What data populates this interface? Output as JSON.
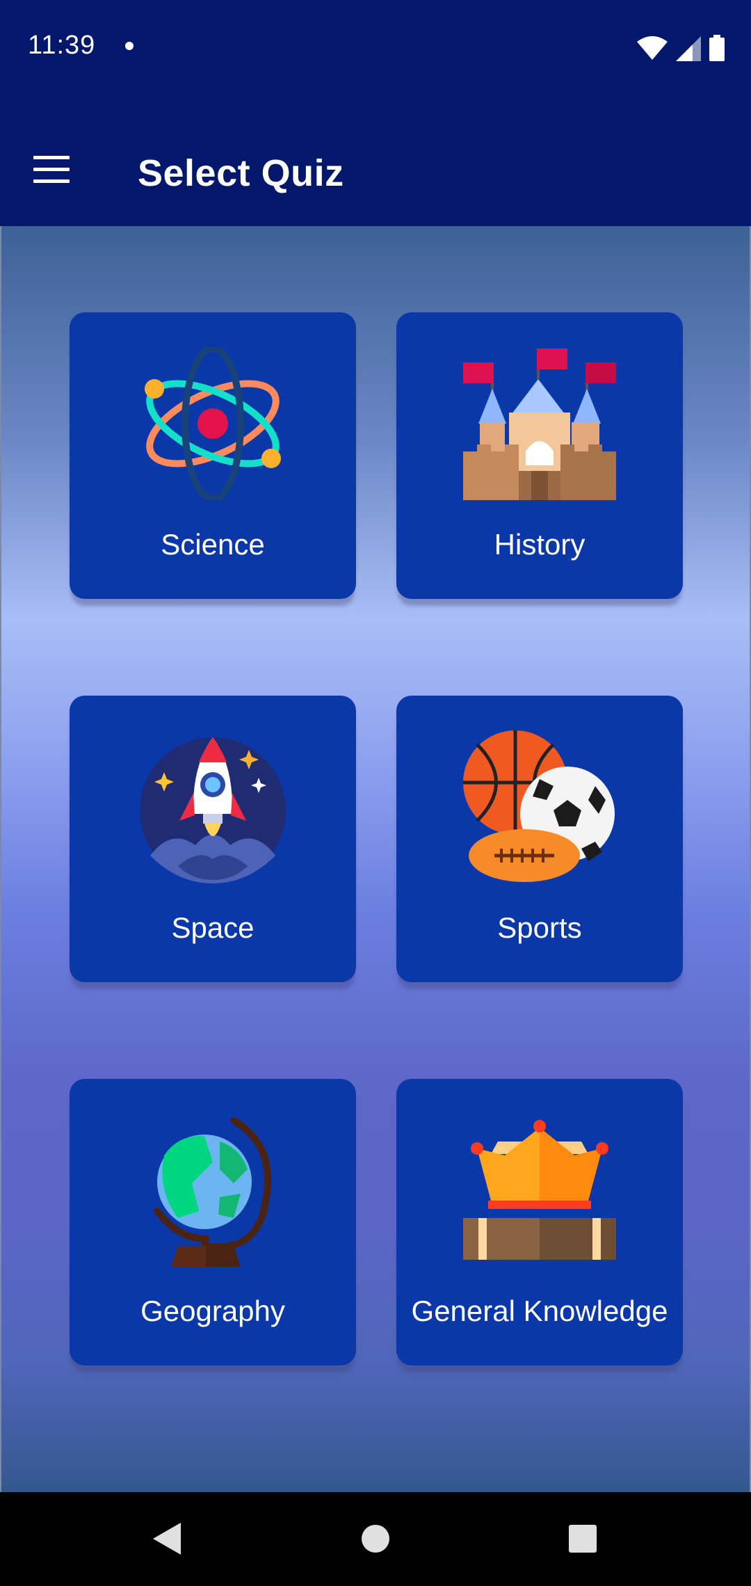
{
  "status_bar": {
    "time": "11:39",
    "icons": [
      "wifi-icon",
      "cell-signal-icon",
      "battery-icon"
    ]
  },
  "app_bar": {
    "title": "Select Quiz",
    "menu_icon": "hamburger-menu-icon"
  },
  "quizzes": [
    {
      "label": "Science",
      "icon": "atom-icon"
    },
    {
      "label": "History",
      "icon": "castle-icon"
    },
    {
      "label": "Space",
      "icon": "rocket-icon"
    },
    {
      "label": "Sports",
      "icon": "sports-balls-icon"
    },
    {
      "label": "Geography",
      "icon": "globe-icon"
    },
    {
      "label": "General Knowledge",
      "icon": "crown-books-icon"
    }
  ],
  "nav_bar": {
    "buttons": [
      "back-icon",
      "home-icon",
      "recents-icon"
    ]
  },
  "colors": {
    "app_bar": "#03186b",
    "card": "#0b38a8",
    "text": "#ffffff"
  }
}
